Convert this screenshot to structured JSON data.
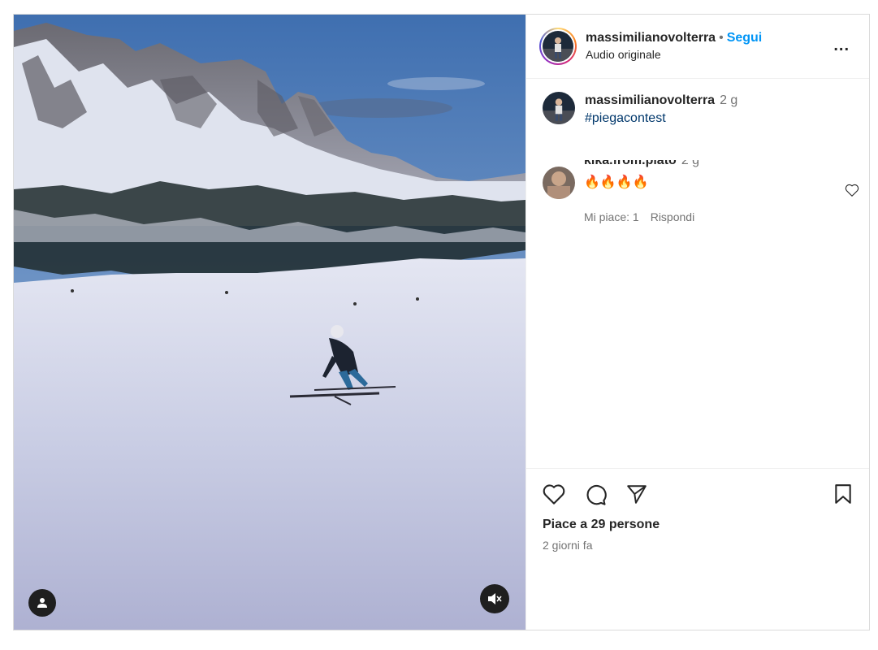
{
  "post": {
    "username": "massimilianovolterra",
    "separator": "•",
    "follow_label": "Segui",
    "audio_label": "Audio originale",
    "more_label": "...",
    "caption": {
      "username": "massimilianovolterra",
      "time": "2 g",
      "text": "#piegacontest"
    },
    "comments": [
      {
        "username": "kika.from.plato",
        "time": "2 g",
        "text": "🔥🔥🔥🔥",
        "likes_label": "Mi piace: 1",
        "reply_label": "Rispondi"
      }
    ],
    "likes_text": "Piace a 29 persone",
    "date_text": "2 giorni fa"
  },
  "icons": {
    "tag": "person-icon",
    "mute": "speaker-muted-icon",
    "like": "heart-icon",
    "comment": "comment-bubble-icon",
    "share": "paper-plane-icon",
    "save": "bookmark-icon",
    "more": "ellipsis-icon"
  },
  "colors": {
    "follow": "#0095f6",
    "hashtag": "#00376b",
    "secondary_text": "#737373",
    "border": "#dbdbdb"
  }
}
